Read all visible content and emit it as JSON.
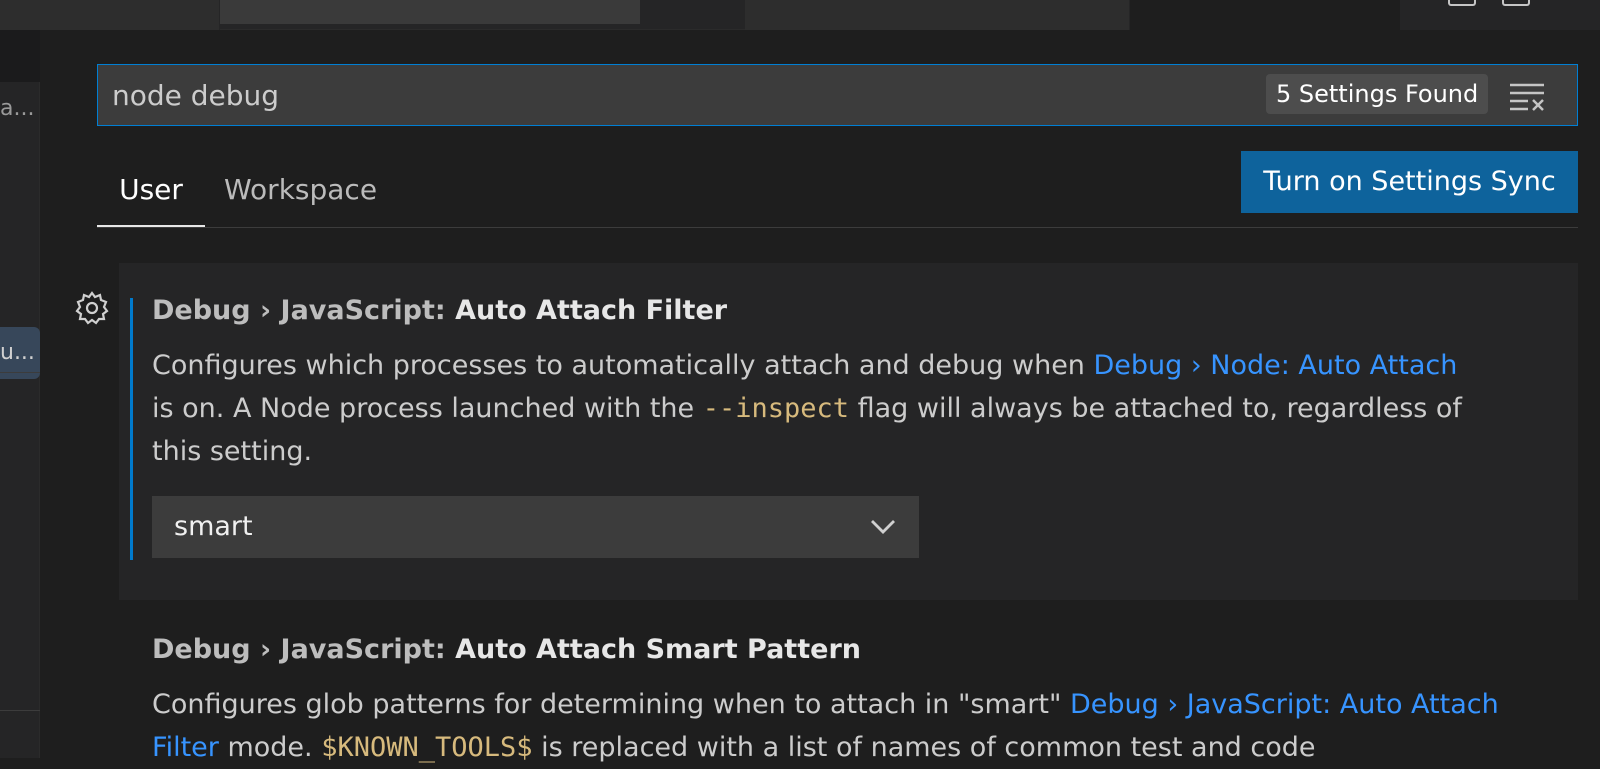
{
  "search": {
    "query": "node debug",
    "results_count": "5 Settings Found"
  },
  "scope_tabs": [
    {
      "label": "User",
      "active": true
    },
    {
      "label": "Workspace",
      "active": false
    }
  ],
  "sync_button_label": "Turn on Settings Sync",
  "sidebar": {
    "items": [
      {
        "label": "a..."
      },
      {
        "label": "u..."
      }
    ]
  },
  "settings": [
    {
      "category": "Debug › JavaScript: ",
      "name": "Auto Attach Filter",
      "description": {
        "part1": "Configures which processes to automatically attach and debug when ",
        "link1": "Debug › Node: Auto Attach",
        "part2": " is on. A Node process launched with the ",
        "code1": "--inspect",
        "part3": " flag will always be attached to, regardless of this setting."
      },
      "value": "smart"
    },
    {
      "category": "Debug › JavaScript: ",
      "name": "Auto Attach Smart Pattern",
      "description": {
        "part1": "Configures glob patterns for determining when to attach in \"smart\" ",
        "link1": "Debug › JavaScript: Auto Attach Filter",
        "part2": " mode. ",
        "code1": "$KNOWN_TOOLS$",
        "part3": " is replaced with a list of names of common test and code"
      }
    }
  ],
  "colors": {
    "accent": "#007fd4",
    "sync_button": "#0e639c",
    "link": "#3794ff",
    "code": "#d7ba7d"
  },
  "icons": [
    "gear-icon",
    "clear-filter-icon",
    "chevron-down-icon"
  ]
}
